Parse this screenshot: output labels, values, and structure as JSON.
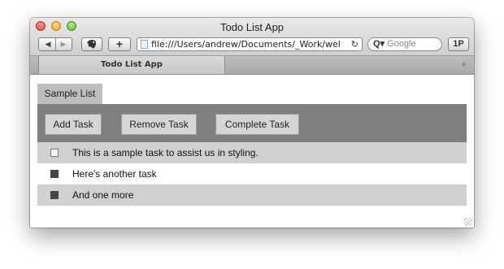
{
  "window": {
    "title": "Todo List App"
  },
  "toolbar": {
    "back_glyph": "◀",
    "forward_glyph": "▶",
    "add_bookmark": "+",
    "password_label": "1P",
    "address": "file:///Users/andrew/Documents/_Work/wel",
    "reload_glyph": "↻",
    "search_placeholder": "Google",
    "search_prefix": "Q▾"
  },
  "tabs": [
    {
      "label": "Todo List App"
    }
  ],
  "new_tab_glyph": "+",
  "list": {
    "tab_label": "Sample List",
    "buttons": {
      "add": "Add Task",
      "remove": "Remove Task",
      "complete": "Complete Task"
    },
    "tasks": [
      {
        "text": "This is a sample task to assist us in styling.",
        "completed": false
      },
      {
        "text": "Here's another task",
        "completed": true
      },
      {
        "text": "And one more",
        "completed": true
      }
    ]
  },
  "colors": {
    "toolbar_bg": "#7f7f7f",
    "button_bg": "#d5d5d5",
    "row_shade": "#d0d0d0",
    "done_box": "#444444"
  },
  "icons": {
    "close": "close-button-icon",
    "minimize": "minimize-button-icon",
    "zoom": "zoom-button-icon",
    "evernote": "elephant-icon",
    "page": "page-icon",
    "reload": "reload-icon",
    "search": "search-icon",
    "resize": "resize-grip-icon"
  }
}
